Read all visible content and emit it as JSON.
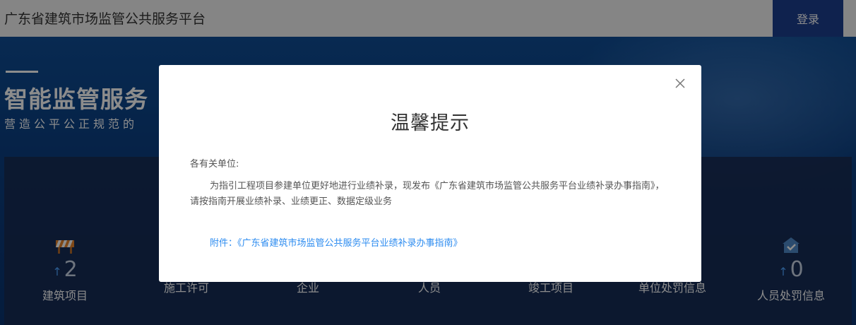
{
  "header": {
    "site_title": "广东省建筑市场监管公共服务平台",
    "login_label": "登录"
  },
  "hero": {
    "title": "智能监管服务",
    "subtitle": "营造公平公正规范的"
  },
  "stats": [
    {
      "label": "建筑项目",
      "value": "2",
      "icon": "barrier-icon"
    },
    {
      "label": "施工许可",
      "value": "",
      "icon": "permit-icon"
    },
    {
      "label": "企业",
      "value": "",
      "icon": "company-icon"
    },
    {
      "label": "人员",
      "value": "",
      "icon": "person-icon"
    },
    {
      "label": "竣工项目",
      "value": "",
      "icon": "completed-icon"
    },
    {
      "label": "单位处罚信息",
      "value": "",
      "icon": "penalty-icon"
    },
    {
      "label": "人员处罚信息",
      "value": "0",
      "icon": "house-check-icon"
    }
  ],
  "modal": {
    "title": "温馨提示",
    "greeting": "各有关单位:",
    "body": "为指引工程项目参建单位更好地进行业绩补录，现发布《广东省建筑市场监管公共服务平台业绩补录办事指南》，请按指南开展业绩补录、业绩更正、数据定级业务",
    "attachment": "附件：《广东省建筑市场监管公共服务平台业绩补录办事指南》"
  },
  "colors": {
    "login_bg": "#1c3f8f",
    "hero_bg": "#0b3f82",
    "link": "#2d8cf0"
  }
}
